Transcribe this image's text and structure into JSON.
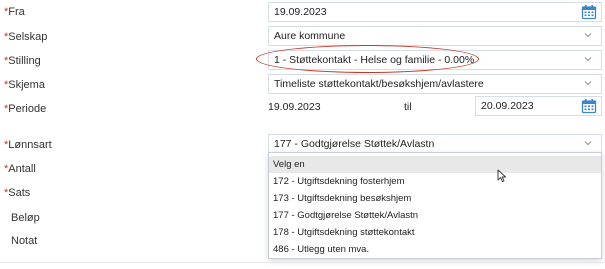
{
  "form": {
    "fra": {
      "label": "Fra",
      "value": "19.09.2023"
    },
    "selskap": {
      "label": "Selskap",
      "value": "Aure kommune"
    },
    "stilling": {
      "label": "Stilling",
      "value": "1 - Støttekontakt - Helse og familie - 0.00%"
    },
    "skjema": {
      "label": "Skjema",
      "value": "Timeliste støttekontakt/besøkshjem/avlastere"
    },
    "periode": {
      "label": "Periode",
      "from": "19.09.2023",
      "til_label": "til",
      "to": "20.09.2023"
    },
    "lonnsart": {
      "label": "Lønnsart",
      "value": "177 - Godtgjørelse Støttek/Avlastn"
    },
    "antall": {
      "label": "Antall"
    },
    "sats": {
      "label": "Sats"
    },
    "belop": {
      "label": "Beløp"
    },
    "notat": {
      "label": "Notat"
    }
  },
  "dropdown": {
    "options": [
      "Velg en",
      "172 - Utgiftsdekning fosterhjem",
      "173 - Utgiftsdekning besøkshjem",
      "177 - Godtgjørelse Støttek/Avlastn",
      "178 - Utgiftsdekning støttekontakt",
      "486 - Utlegg uten mva."
    ],
    "highlighted_index": 0
  },
  "required_marker": "*",
  "colors": {
    "required": "#c0392b",
    "annotation": "#c0392b",
    "calendar_icon": "#3a86c8",
    "field_border": "#d6dde6"
  },
  "icons": [
    "calendar-icon",
    "chevron-down-icon",
    "mouse-pointer-icon"
  ]
}
